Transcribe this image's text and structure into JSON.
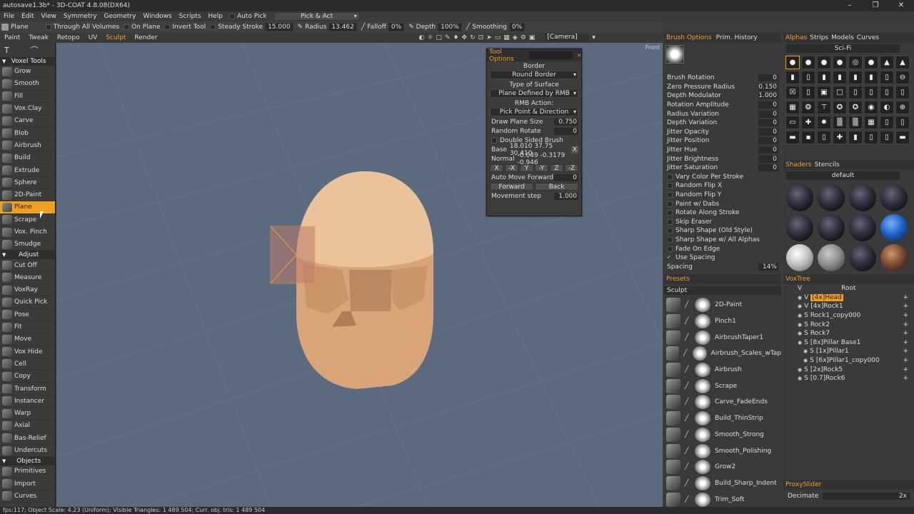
{
  "window": {
    "title": "autosave1.3b* - 3D-COAT 4.8.08(DX64)"
  },
  "menu": [
    "File",
    "Edit",
    "View",
    "Symmetry",
    "Geometry",
    "Windows",
    "Scripts",
    "Help"
  ],
  "autopick": {
    "label": "Auto Pick",
    "mode": "Pick & Act"
  },
  "toolbar": {
    "plane_label": "Plane",
    "through_volumes": "Through All Volumes",
    "on_plane": "On Plane",
    "invert_tool": "Invert Tool",
    "steady_stroke_label": "Steady Stroke",
    "steady_stroke_value": "15.000",
    "radius_label": "Radius",
    "radius_value": "13.462",
    "falloff_label": "Falloff",
    "falloff_value": "0%",
    "depth_label": "Depth",
    "depth_value": "100%",
    "smoothing_label": "Smoothing",
    "smoothing_value": "0%"
  },
  "rooms": [
    "Paint",
    "Tweak",
    "Retopo",
    "UV",
    "Sculpt",
    "Render"
  ],
  "active_room": "Sculpt",
  "camera_label": "[Camera]",
  "viewport": {
    "view_label": "Front"
  },
  "left_panel": {
    "voxel_tools_header": "Voxel Tools",
    "voxel_tools": [
      "Grow",
      "Smooth",
      "Fill",
      "Vox.Clay",
      "Carve",
      "Blob",
      "Airbrush",
      "Build",
      "Extrude",
      "Sphere",
      "2D-Paint",
      "Plane",
      "Scrape",
      "Vox. Pinch",
      "Smudge"
    ],
    "adjust_header": "Adjust",
    "adjust_tools": [
      "Cut Off",
      "Measure",
      "VoxRay",
      "Quick Pick",
      "Pose",
      "Fit",
      "Move",
      "Vox Hide",
      "Cell",
      "Copy",
      "Transform",
      "Instancer",
      "Warp",
      "Axial",
      "Bas-Relief",
      "Undercuts"
    ],
    "objects_header": "Objects",
    "object_tools": [
      "Primitives",
      "Import",
      "Curves"
    ]
  },
  "tool_options": {
    "title": "Tool Options",
    "border_label": "Border",
    "border_value": "Round Border",
    "surface_label": "Type of Surface",
    "surface_value": "Plane Defined by RMB",
    "rmb_label": "RMB Action:",
    "rmb_value": "Pick Point & Direction",
    "draw_plane_size_label": "Draw Plane Size",
    "draw_plane_size_value": "0.750",
    "random_rotate_label": "Random Rotate",
    "random_rotate_value": "0",
    "double_sided_label": "Double Sided Brush",
    "base_label": "Base",
    "base_values": "18.010 37.75 30.410",
    "base_x": "X",
    "normal_label": "Normal",
    "normal_values": "-0.049 -0.3179 -0.946",
    "axis_buttons": [
      "X",
      "-X",
      "Y",
      "-Y",
      "Z",
      "-Z"
    ],
    "auto_move_label": "Auto Move Forward",
    "auto_move_value": "0",
    "forward_label": "Forward",
    "back_label": "Back",
    "movement_step_label": "Movement step",
    "movement_step_value": "1.000"
  },
  "brush_panel": {
    "tabs": [
      "Brush Options",
      "Prim. History"
    ],
    "params": [
      {
        "label": "Brush Rotation",
        "value": "0"
      },
      {
        "label": "Zero Pressure Radius",
        "value": "0.150"
      },
      {
        "label": "Depth Modulator",
        "value": "1.000"
      },
      {
        "label": "Rotation Amplitude",
        "value": "0"
      },
      {
        "label": "Radius Variation",
        "value": "0"
      },
      {
        "label": "Depth Variation",
        "value": "0"
      },
      {
        "label": "Jitter Opacity",
        "value": "0"
      },
      {
        "label": "Jitter Position",
        "value": "0"
      },
      {
        "label": "Jitter Hue",
        "value": "0"
      },
      {
        "label": "Jitter Brightness",
        "value": "0"
      },
      {
        "label": "Jitter Saturation",
        "value": "0"
      }
    ],
    "checks": [
      "Vary Color Per Stroke",
      "Random Flip X",
      "Random Flip Y",
      "Paint w/ Dabs",
      "Rotate Along Stroke",
      "Skip Eraser",
      "Sharp Shape (Old Style)",
      "Sharp Shape w/ All Alphas",
      "Fade On Edge",
      "Use Spacing"
    ],
    "spacing_label": "Spacing",
    "spacing_value": "14%"
  },
  "presets": {
    "header": "Presets",
    "sub": "Sculpt",
    "items": [
      "2D-Paint",
      "Pinch1",
      "AirbrushTaper1",
      "Airbrush_Scales_wTap",
      "Airbrush",
      "Scrape",
      "Carve_FadeEnds",
      "Build_ThinStrip",
      "Smooth_Strong",
      "Smooth_Polishing",
      "Grow2",
      "Build_Sharp_Indent",
      "Trim_Soft"
    ]
  },
  "alphas": {
    "tabs": [
      "Alphas",
      "Strips",
      "Models",
      "Curves"
    ],
    "set_name": "Sci-Fi",
    "glyphs": [
      "●",
      "●",
      "●",
      "●",
      "◎",
      "●",
      "▲",
      "▲",
      "▮",
      "▯",
      "▮",
      "▮",
      "▮",
      "▮",
      "▯",
      "⊖",
      "☒",
      "▯",
      "▣",
      "□",
      "▯",
      "▯",
      "▯",
      "▯",
      "▦",
      "❂",
      "⊤",
      "✪",
      "✪",
      "◉",
      "◐",
      "⊕",
      "▭",
      "✚",
      "✹",
      "▒",
      "▒",
      "▦",
      "▯",
      "▯",
      "▬",
      "▪",
      "▯",
      "✚",
      "▮",
      "▯",
      "▯",
      "▬"
    ]
  },
  "shaders": {
    "tabs": [
      "Shaders",
      "Stencils"
    ],
    "set_name": "default"
  },
  "voxtree": {
    "header": "VoxTree",
    "root": "Root",
    "items": [
      {
        "prefix": "V",
        "name": "[4x]Head",
        "selected": true
      },
      {
        "prefix": "V",
        "name": "[4x]Rock1",
        "selected": false
      },
      {
        "prefix": "S",
        "name": "Rock1_copy000",
        "selected": false
      },
      {
        "prefix": "S",
        "name": "Rock2",
        "selected": false
      },
      {
        "prefix": "S",
        "name": "Rock7",
        "selected": false
      },
      {
        "prefix": "S",
        "name": "[8x]Pillar Base1",
        "selected": false
      },
      {
        "prefix": "S",
        "name": "[1x]Pillar1",
        "selected": false
      },
      {
        "prefix": "S",
        "name": "[6x]Pillar1_copy000",
        "selected": false
      },
      {
        "prefix": "S",
        "name": "[2x]Rock5",
        "selected": false
      },
      {
        "prefix": "S",
        "name": "[0.7]Rock6",
        "selected": false
      }
    ]
  },
  "proxy": {
    "header": "ProxySlider",
    "decimate_label": "Decimate",
    "decimate_value": "2x"
  },
  "status": "fps:117;    Object Scale: 4.23 (Uniform); Visible Triangles: 1 489 504; Curr. obj. tris: 1 489 504",
  "colors": {
    "accent": "#f0a020",
    "viewport": "#5b6a7e",
    "skin": "#e2b388"
  }
}
